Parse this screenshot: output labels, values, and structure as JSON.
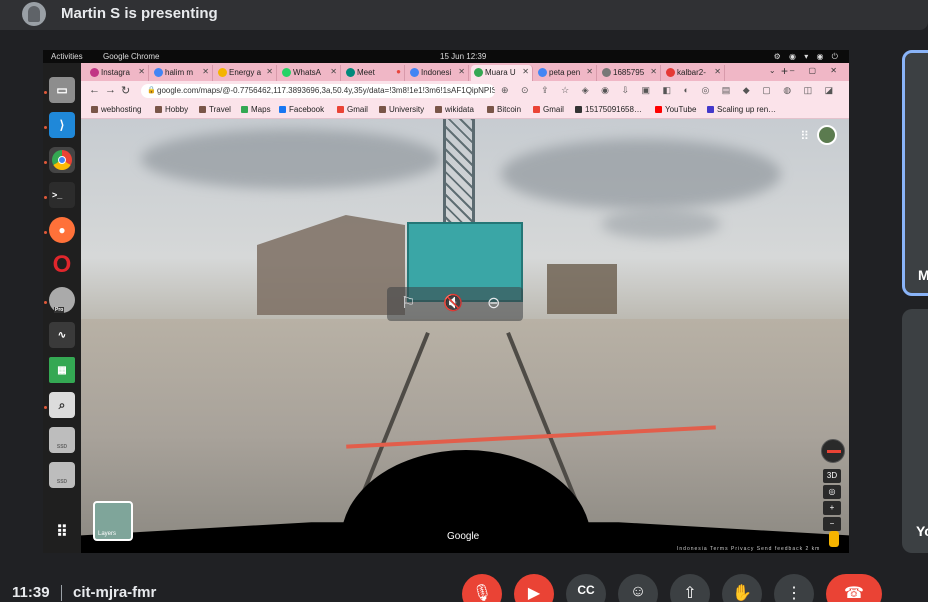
{
  "presenter": {
    "text": "Martin S is presenting"
  },
  "screen": {
    "topbar": {
      "activities": "Activities",
      "app": "Google Chrome",
      "datetime": "15 Jun  12:39"
    },
    "tabs": [
      {
        "label": "Instagra",
        "color": "#c13584"
      },
      {
        "label": "halim m",
        "color": "#4285f4"
      },
      {
        "label": "Energy a",
        "color": "#f4b400"
      },
      {
        "label": "WhatsA",
        "color": "#25d366"
      },
      {
        "label": "Meet",
        "color": "#00897b"
      },
      {
        "label": "Indonesi",
        "color": "#4285f4"
      },
      {
        "label": "Muara U",
        "color": "#34a853"
      },
      {
        "label": "peta pen",
        "color": "#4285f4"
      },
      {
        "label": "1685795",
        "color": "#777777"
      },
      {
        "label": "kalbar2-",
        "color": "#e53935"
      }
    ],
    "active_tab_index": 6,
    "url": "google.com/maps/@-0.7756462,117.3893696,3a,50.4y,35y/data=!3m8!1e1!3m6!1sAF1QipNPIS8k_...",
    "bookmarks": [
      {
        "label": "webhosting",
        "color": "#795548"
      },
      {
        "label": "Hobby",
        "color": "#795548"
      },
      {
        "label": "Travel",
        "color": "#795548"
      },
      {
        "label": "Maps",
        "color": "#34a853"
      },
      {
        "label": "Facebook",
        "color": "#1877f2"
      },
      {
        "label": "Gmail",
        "color": "#ea4335"
      },
      {
        "label": "University",
        "color": "#795548"
      },
      {
        "label": "wikidata",
        "color": "#795548"
      },
      {
        "label": "Bitcoin",
        "color": "#795548"
      },
      {
        "label": "Gmail",
        "color": "#ea4335"
      },
      {
        "label": "15175091658…",
        "color": "#333333"
      },
      {
        "label": "YouTube",
        "color": "#ff0000"
      },
      {
        "label": "Scaling up ren…",
        "color": "#4338ca"
      }
    ],
    "streetview": {
      "google_label": "Google",
      "layers_label": "Layers",
      "control_3d": "3D",
      "footer_links": "Indonesia  Terms  Privacy  Send feedback  2 km"
    },
    "dock_icons": [
      "files-icon",
      "vscode-icon",
      "chrome-icon",
      "terminal-icon",
      "firefox-icon",
      "opera-icon",
      "google-earth-icon",
      "system-monitor-icon",
      "spreadsheet-icon",
      "search-app-icon",
      "ssd-drive-icon",
      "ssd-drive-icon",
      "app-grid-icon"
    ],
    "dock_labels": {
      "pro": "Pro",
      "ssd": "SSD"
    }
  },
  "participants": [
    {
      "initial": "M"
    },
    {
      "initial": "Yo"
    }
  ],
  "bottom": {
    "time": "11:39",
    "meeting_code": "cit-mjra-fmr"
  },
  "colors": {
    "accent_blue": "#8ab4f8",
    "danger_red": "#ea4335",
    "panel": "#3c4043"
  }
}
